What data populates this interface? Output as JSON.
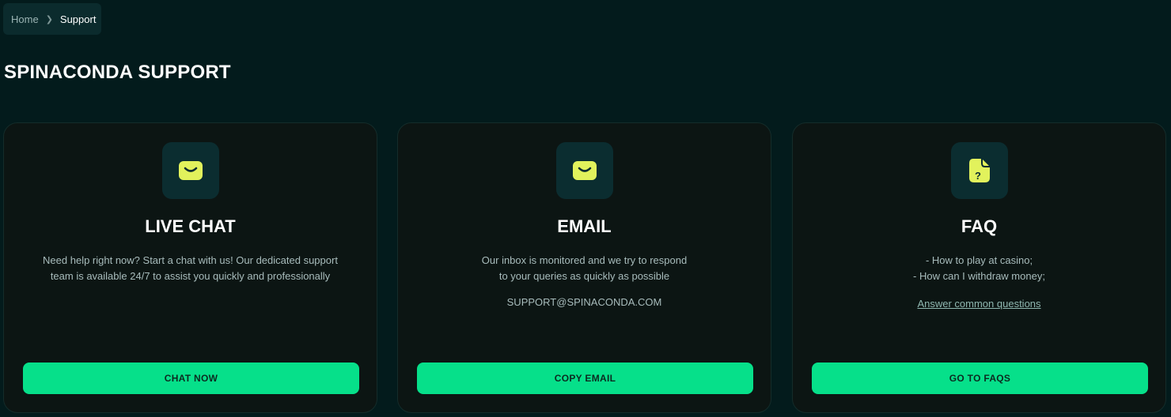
{
  "breadcrumb": {
    "home": "Home",
    "current": "Support"
  },
  "page": {
    "title": "SPINACONDA SUPPORT"
  },
  "cards": [
    {
      "icon": "chat-bubble-icon",
      "title": "LIVE CHAT",
      "description_lines": [
        "Need help right now? Start a chat with us! Our dedicated support",
        "team is available 24/7 to assist you quickly and professionally"
      ],
      "button": "CHAT NOW"
    },
    {
      "icon": "envelope-icon",
      "title": "EMAIL",
      "description_lines": [
        "Our inbox is monitored and we try to respond",
        "to your queries as quickly as possible"
      ],
      "email": "SUPPORT@SPINACONDA.COM",
      "button": "COPY EMAIL"
    },
    {
      "icon": "question-document-icon",
      "title": "FAQ",
      "description_lines": [
        "- How to play at casino;",
        "- How can I withdraw money;"
      ],
      "link": "Answer common questions",
      "button": "GO TO FAQS"
    }
  ],
  "colors": {
    "background": "#031b1c",
    "card": "#0c1513",
    "icon_box": "#0b2d30",
    "icon_accent": "#e2f25c",
    "button": "#06e08a"
  }
}
